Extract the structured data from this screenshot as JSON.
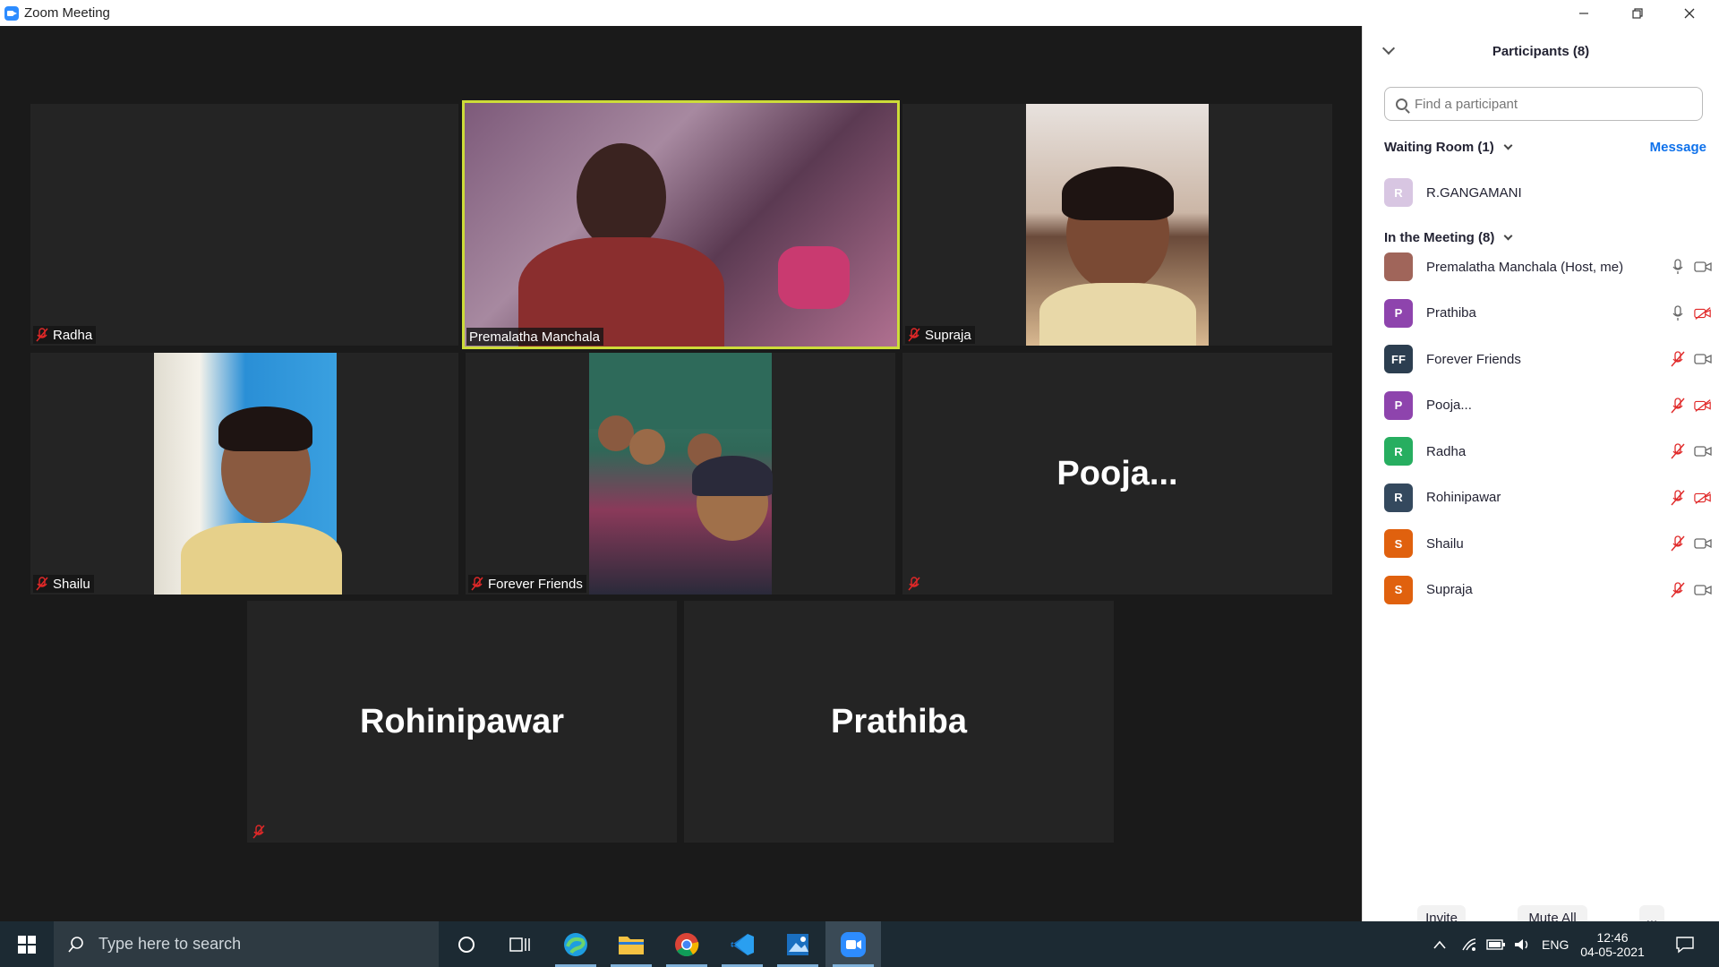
{
  "window": {
    "title": "Zoom Meeting"
  },
  "tiles": [
    {
      "name": "Radha",
      "video": false,
      "muted": true
    },
    {
      "name": "Premalatha Manchala",
      "video": true,
      "muted": false,
      "active_speaker": true
    },
    {
      "name": "Supraja",
      "video": true,
      "muted": true
    },
    {
      "name": "Shailu",
      "video": true,
      "muted": true
    },
    {
      "name": "Forever Friends",
      "video": true,
      "muted": true
    },
    {
      "name": "Pooja...",
      "video": false,
      "muted": true,
      "display_name_only": true
    },
    {
      "name": "Rohinipawar",
      "video": false,
      "muted": true,
      "display_name_only": true
    },
    {
      "name": "Prathiba",
      "video": false,
      "muted": false,
      "display_name_only": true
    }
  ],
  "panel": {
    "title": "Participants (8)",
    "search_placeholder": "Find a participant",
    "waiting_room_label": "Waiting Room (1)",
    "message_label": "Message",
    "waiting": [
      {
        "initial": "R",
        "name": "R.GANGAMANI",
        "color": "#d8c6e2"
      }
    ],
    "in_meeting_label": "In the Meeting (8)",
    "participants": [
      {
        "initial": "",
        "name": "Premalatha Manchala (Host, me)",
        "color": "#a0655a",
        "mic": "on",
        "cam": "on"
      },
      {
        "initial": "P",
        "name": "Prathiba",
        "color": "#8e44ad",
        "mic": "on",
        "cam": "off"
      },
      {
        "initial": "FF",
        "name": "Forever Friends",
        "color": "#2c3e50",
        "mic": "off",
        "cam": "on"
      },
      {
        "initial": "P",
        "name": "Pooja...",
        "color": "#8e44ad",
        "mic": "off",
        "cam": "off"
      },
      {
        "initial": "R",
        "name": "Radha",
        "color": "#27ae60",
        "mic": "off",
        "cam": "on"
      },
      {
        "initial": "R",
        "name": "Rohinipawar",
        "color": "#34495e",
        "mic": "off",
        "cam": "off"
      },
      {
        "initial": "S",
        "name": "Shailu",
        "color": "#e0610e",
        "mic": "off",
        "cam": "on"
      },
      {
        "initial": "S",
        "name": "Supraja",
        "color": "#e0610e",
        "mic": "off",
        "cam": "on"
      }
    ],
    "invite_label": "Invite",
    "mute_all_label": "Mute All",
    "more_label": "..."
  },
  "taskbar": {
    "search_placeholder": "Type here to search",
    "language": "ENG",
    "time": "12:46",
    "date": "04-05-2021"
  }
}
